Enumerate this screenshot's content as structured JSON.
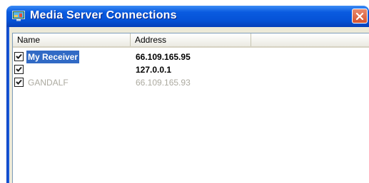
{
  "window": {
    "title": "Media Server Connections",
    "icon": "media-server-icon",
    "close_icon": "close-icon",
    "accent_color": "#0a5be0",
    "close_color": "#d6532e"
  },
  "list": {
    "columns": [
      {
        "label": "Name"
      },
      {
        "label": "Address"
      }
    ],
    "rows": [
      {
        "checked": true,
        "name": "My Receiver",
        "address": "66.109.165.95",
        "selected": true,
        "enabled": true
      },
      {
        "checked": true,
        "name": "",
        "address": "127.0.0.1",
        "selected": false,
        "enabled": true
      },
      {
        "checked": true,
        "name": "GANDALF",
        "address": "66.109.165.93",
        "selected": false,
        "enabled": false
      }
    ],
    "selection_color": "#316ac5"
  }
}
